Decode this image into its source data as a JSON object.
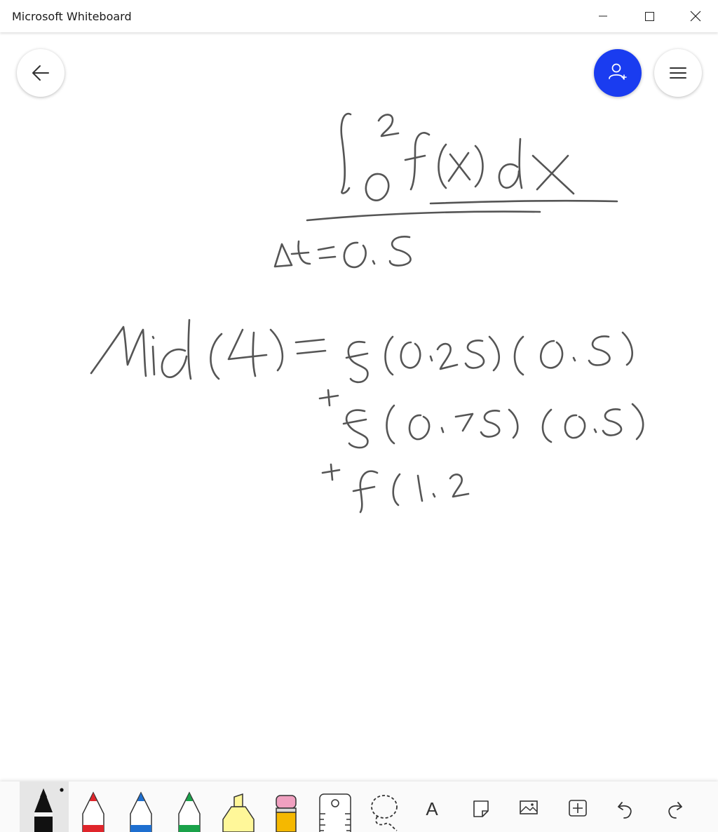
{
  "window": {
    "title": "Microsoft Whiteboard",
    "controls": [
      "minimize",
      "maximize",
      "close"
    ]
  },
  "navigation": {
    "back_icon": "arrow-left-icon",
    "invite_icon": "add-person-icon",
    "menu_icon": "hamburger-menu-icon"
  },
  "colors": {
    "accent": "#1a3cf0",
    "ink": "#555555",
    "pen_black": "#111111",
    "pen_red": "#e0252b",
    "pen_blue": "#1e6fd0",
    "pen_green": "#1aa24a",
    "highlighter_yellow": "#fff799",
    "eraser_pink": "#f0a0c0",
    "pencil_yellow": "#f5b800"
  },
  "toolbar": {
    "tools": [
      {
        "name": "black-pen",
        "icon": "black-pen-icon",
        "selected": true
      },
      {
        "name": "red-pen",
        "icon": "red-pen-icon",
        "selected": false
      },
      {
        "name": "blue-pen",
        "icon": "blue-pen-icon",
        "selected": false
      },
      {
        "name": "green-pen",
        "icon": "green-pen-icon",
        "selected": false
      },
      {
        "name": "highlighter",
        "icon": "highlighter-icon",
        "selected": false
      },
      {
        "name": "eraser",
        "icon": "eraser-icon",
        "selected": false
      },
      {
        "name": "ruler",
        "icon": "ruler-icon",
        "selected": false
      },
      {
        "name": "lasso",
        "icon": "lasso-icon",
        "selected": false
      },
      {
        "name": "text",
        "icon": "text-icon",
        "label": "A",
        "selected": false
      },
      {
        "name": "sticky-note",
        "icon": "sticky-note-icon",
        "selected": false
      },
      {
        "name": "image",
        "icon": "image-icon",
        "selected": false
      },
      {
        "name": "insert",
        "icon": "add-square-icon",
        "selected": false
      },
      {
        "name": "undo",
        "icon": "undo-icon",
        "selected": false
      },
      {
        "name": "redo",
        "icon": "redo-icon",
        "selected": false
      }
    ]
  }
}
